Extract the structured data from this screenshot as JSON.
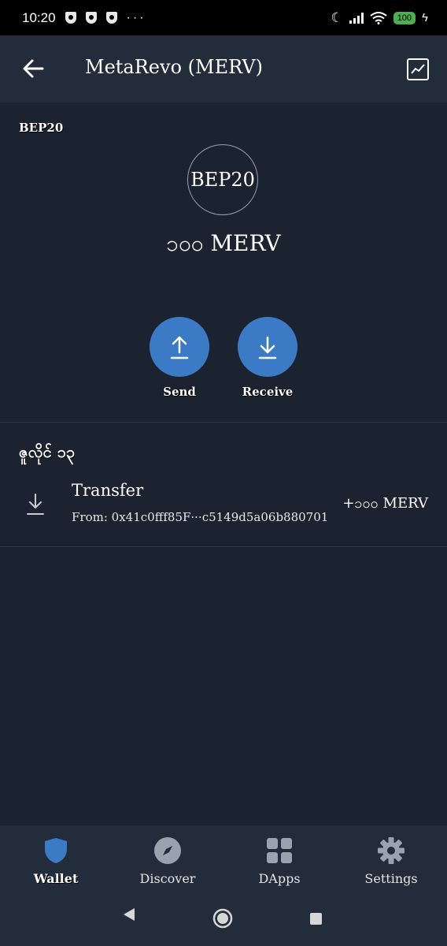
{
  "status_bar": {
    "time": "10:20",
    "dots": "···",
    "battery": "100"
  },
  "header": {
    "title": "MetaRevo (MERV)"
  },
  "token": {
    "network": "BEP20",
    "logo_text": "BEP20",
    "balance": "၁၀၀ MERV"
  },
  "actions": {
    "send_label": "Send",
    "receive_label": "Receive"
  },
  "transactions": {
    "date": "ဇူလိုင် ၁၃",
    "items": [
      {
        "type": "Transfer",
        "from": "From: 0x41c0fff85F···c5149d5a06b880701",
        "amount": "+၁၀၀ MERV"
      }
    ]
  },
  "bottom_nav": {
    "items": [
      {
        "label": "Wallet",
        "icon": "shield-icon",
        "active": true
      },
      {
        "label": "Discover",
        "icon": "compass-icon",
        "active": false
      },
      {
        "label": "DApps",
        "icon": "grid-icon",
        "active": false
      },
      {
        "label": "Settings",
        "icon": "gear-icon",
        "active": false
      }
    ]
  },
  "colors": {
    "background": "#1c2330",
    "header": "#232c3a",
    "accent": "#3b7ac4",
    "active_icon": "#3b7ac4",
    "inactive_icon": "#9aa3ad"
  }
}
